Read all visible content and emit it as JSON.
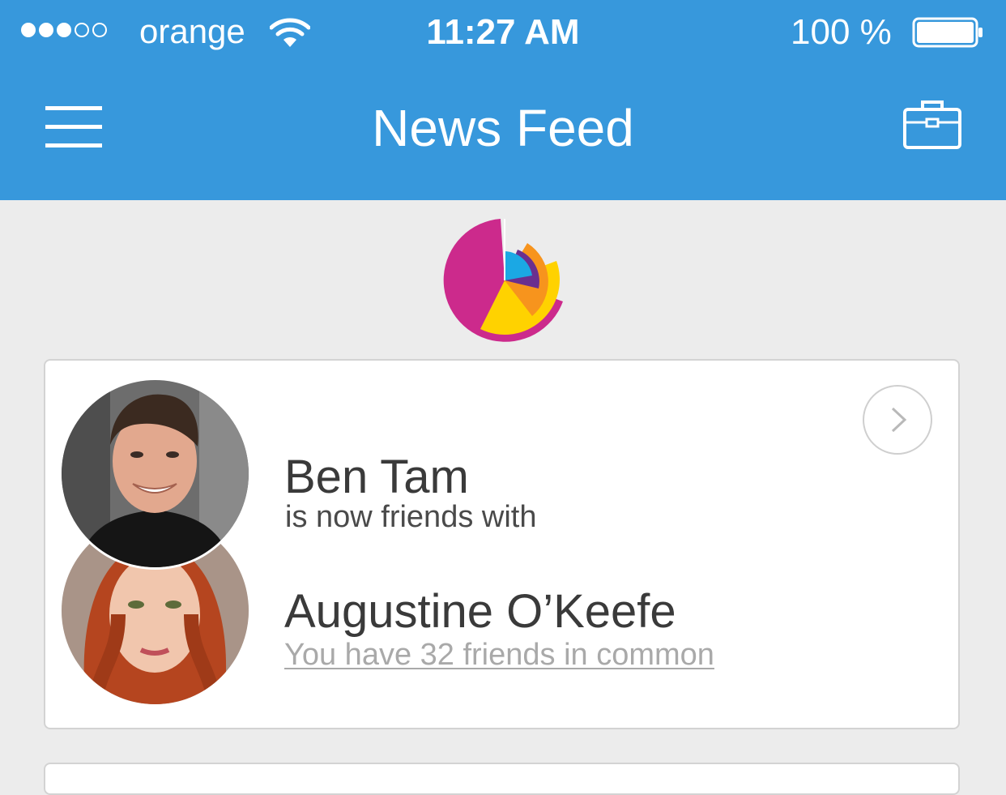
{
  "status_bar": {
    "signal": {
      "filled": 3,
      "total": 5
    },
    "carrier": "orange",
    "time": "11:27 AM",
    "battery_percent": "100 %",
    "battery_level": 1.0
  },
  "nav": {
    "title": "News Feed",
    "left_icon": "hamburger-menu-icon",
    "right_icon": "briefcase-icon"
  },
  "colors": {
    "nav_bg": "#3798dc",
    "page_bg": "#ececec",
    "logo_magenta": "#cc2a8c",
    "logo_yellow": "#ffd200",
    "logo_orange": "#f7941d",
    "logo_purple": "#6a2f8f",
    "logo_blue": "#1ba8e4"
  },
  "feed": {
    "items": [
      {
        "actor": "Ben Tam",
        "action": "is now friends with",
        "friend": "Augustine O’Keefe",
        "common_friends": "You have 32 friends in common",
        "action_icon": "chevron-right-icon"
      }
    ]
  }
}
